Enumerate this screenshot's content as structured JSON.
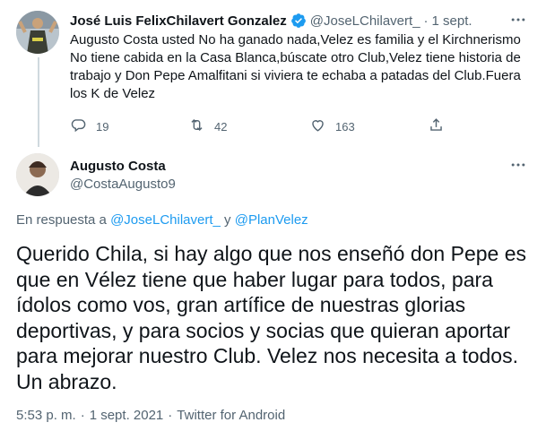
{
  "tweet1": {
    "display_name": "José Luis FelixChilavert Gonzalez",
    "handle": "@JoseLChilavert_",
    "separator": "·",
    "date": "1 sept.",
    "text": "Augusto Costa usted No ha ganado nada,Velez es familia y el Kirchnerismo No tiene cabida en la Casa Blanca,búscate otro Club,Velez tiene historia de trabajo y Don Pepe Amalfitani si viviera te echaba a patadas del Club.Fuera los K de Velez",
    "replies": "19",
    "retweets": "42",
    "likes": "163"
  },
  "tweet2": {
    "display_name": "Augusto Costa",
    "handle": "@CostaAugusto9",
    "reply_prefix": "En respuesta a",
    "reply_to_1": "@JoseLChilavert_",
    "reply_conj": "y",
    "reply_to_2": "@PlanVelez",
    "text": "Querido Chila, si hay algo que nos enseñó don Pepe es que en Vélez tiene que haber lugar para todos, para ídolos como vos, gran artífice de nuestras glorias deportivas, y para socios y socias que quieran aportar para mejorar nuestro Club. Velez nos necesita a todos. Un abrazo.",
    "time": "5:53 p. m.",
    "sep": "·",
    "date": "1 sept. 2021",
    "source": "Twitter for Android"
  },
  "colors": {
    "accent": "#1d9bf0",
    "muted": "#536471",
    "text": "#0f1419"
  }
}
